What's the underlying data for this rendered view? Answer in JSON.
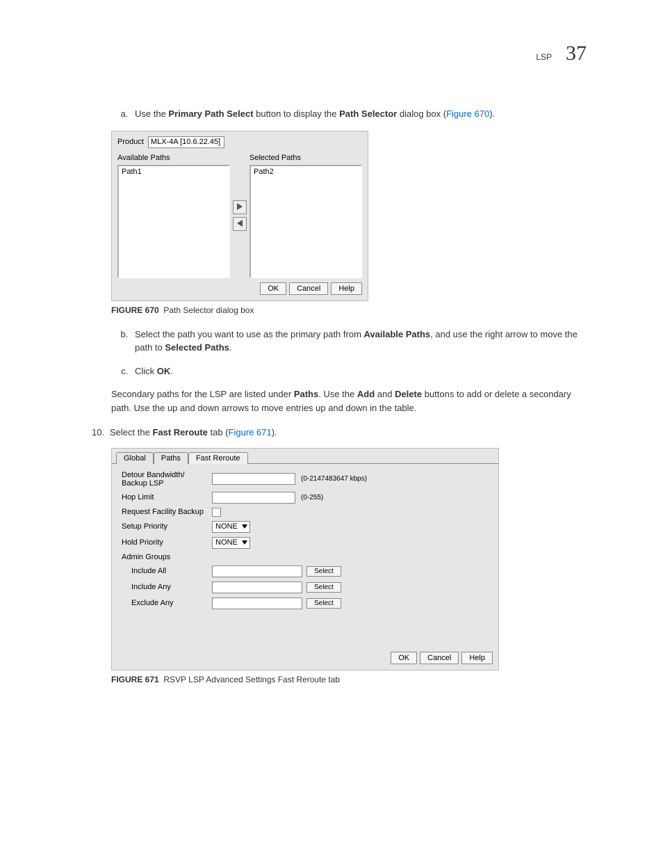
{
  "header": {
    "section": "LSP",
    "chapter": "37"
  },
  "step_a": {
    "letter": "a.",
    "pre": "Use the ",
    "b1": "Primary Path Select",
    "mid": " button to display the ",
    "b2": "Path Selector",
    "post": " dialog box (",
    "link": "Figure 670",
    "end": ")."
  },
  "fig670": {
    "product_label": "Product",
    "product_value": "MLX-4A [10.6.22.45]",
    "available_label": "Available Paths",
    "selected_label": "Selected Paths",
    "available_item": "Path1",
    "selected_item": "Path2",
    "ok": "OK",
    "cancel": "Cancel",
    "help": "Help",
    "caption_bold": "FIGURE 670",
    "caption_text": "Path Selector dialog box"
  },
  "step_b": {
    "letter": "b.",
    "pre": "Select the path you want to use as the primary path from ",
    "b1": "Available Paths",
    "mid": ", and use the right arrow to move the path to ",
    "b2": "Selected Paths",
    "end": "."
  },
  "step_c": {
    "letter": "c.",
    "pre": "Click ",
    "b1": "OK",
    "end": "."
  },
  "para1": {
    "pre": "Secondary paths for the LSP are listed under ",
    "b1": "Paths",
    "mid1": ". Use the ",
    "b2": "Add",
    "mid2": " and ",
    "b3": "Delete",
    "post": " buttons to add or delete a secondary path. Use the up and down arrows to move entries up and down in the table."
  },
  "step10": {
    "num": "10.",
    "pre": "Select the ",
    "b1": "Fast Reroute",
    "mid": " tab (",
    "link": "Figure 671",
    "end": ")."
  },
  "fig671": {
    "tabs": {
      "global": "Global",
      "paths": "Paths",
      "fast": "Fast Reroute"
    },
    "rows": {
      "detour": "Detour Bandwidth/ Backup LSP",
      "detour_hint": "(0-2147483647 kbps)",
      "hop": "Hop Limit",
      "hop_hint": "(0-255)",
      "facility": "Request Facility Backup",
      "setup": "Setup Priority",
      "hold": "Hold Priority",
      "none": "NONE",
      "admin": "Admin Groups",
      "inc_all": "Include All",
      "inc_any": "Include Any",
      "exc_any": "Exclude Any",
      "select": "Select"
    },
    "ok": "OK",
    "cancel": "Cancel",
    "help": "Help",
    "caption_bold": "FIGURE 671",
    "caption_text": "RSVP LSP Advanced Settings Fast Reroute tab"
  }
}
